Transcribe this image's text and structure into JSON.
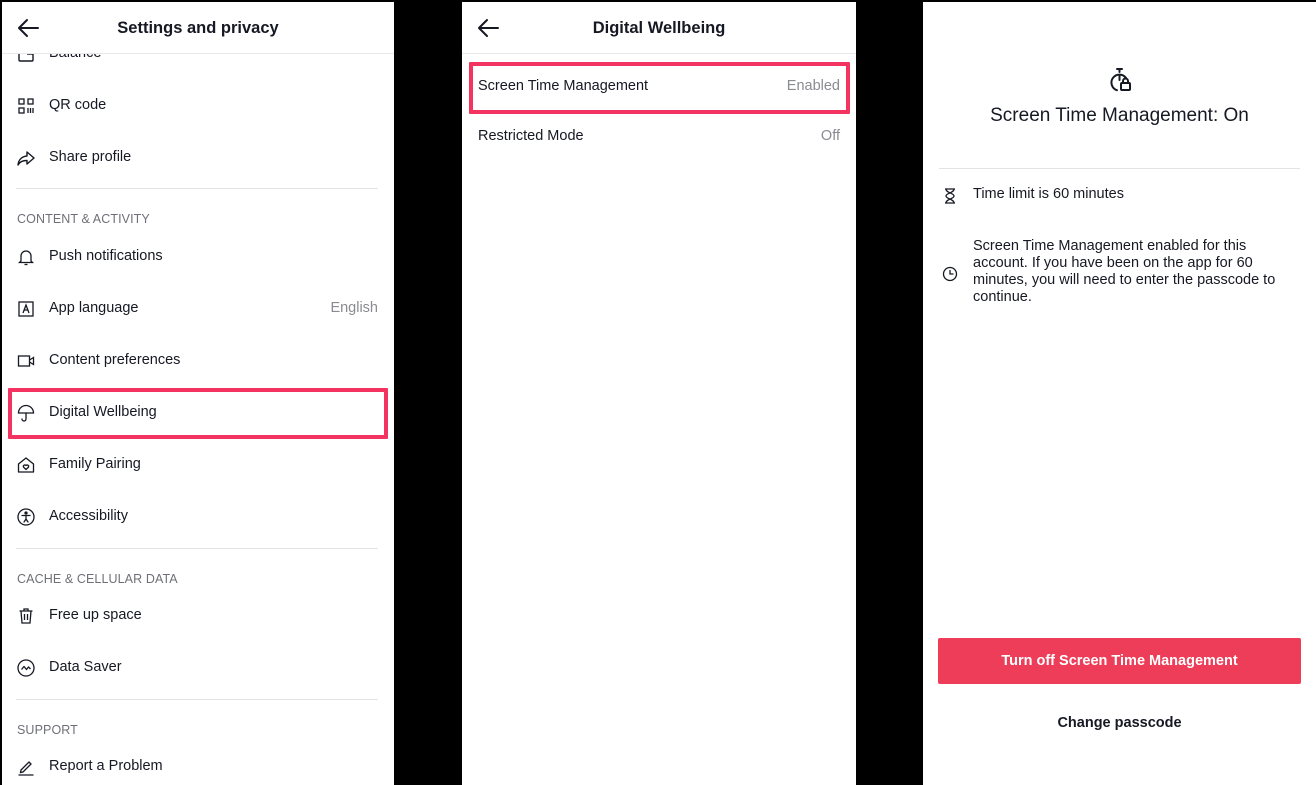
{
  "settings_panel": {
    "title": "Settings and privacy",
    "partial_item": "Balance",
    "items_top": [
      {
        "label": "QR code",
        "icon": "qr-code-icon"
      },
      {
        "label": "Share profile",
        "icon": "share-icon"
      }
    ],
    "sections": [
      {
        "header": "CONTENT & ACTIVITY",
        "items": [
          {
            "label": "Push notifications",
            "icon": "bell-icon"
          },
          {
            "label": "App language",
            "icon": "language-icon",
            "value": "English"
          },
          {
            "label": "Content preferences",
            "icon": "video-icon"
          },
          {
            "label": "Digital Wellbeing",
            "icon": "umbrella-icon",
            "highlighted": true
          },
          {
            "label": "Family Pairing",
            "icon": "family-pairing-icon"
          },
          {
            "label": "Accessibility",
            "icon": "accessibility-icon"
          }
        ]
      },
      {
        "header": "CACHE & CELLULAR DATA",
        "items": [
          {
            "label": "Free up space",
            "icon": "trash-icon"
          },
          {
            "label": "Data Saver",
            "icon": "data-saver-icon"
          }
        ]
      },
      {
        "header": "SUPPORT",
        "items": [
          {
            "label": "Report a Problem",
            "icon": "pencil-icon"
          }
        ]
      }
    ]
  },
  "wellbeing_panel": {
    "title": "Digital Wellbeing",
    "items": [
      {
        "label": "Screen Time Management",
        "value": "Enabled",
        "highlighted": true
      },
      {
        "label": "Restricted Mode",
        "value": "Off"
      }
    ]
  },
  "screen_time_panel": {
    "title": "Screen Time Management: On",
    "info": [
      {
        "icon": "hourglass-icon",
        "text": "Time limit is 60 minutes"
      },
      {
        "icon": "clock-icon",
        "text": "Screen Time Management enabled for this account. If you have been on the app for 60 minutes, you will need to enter the passcode to continue."
      }
    ],
    "primary_button": "Turn off Screen Time Management",
    "secondary_button": "Change passcode"
  },
  "colors": {
    "accent": "#ee3d59",
    "highlight_border": "#f33460",
    "secondary_text": "#8a8b91"
  }
}
